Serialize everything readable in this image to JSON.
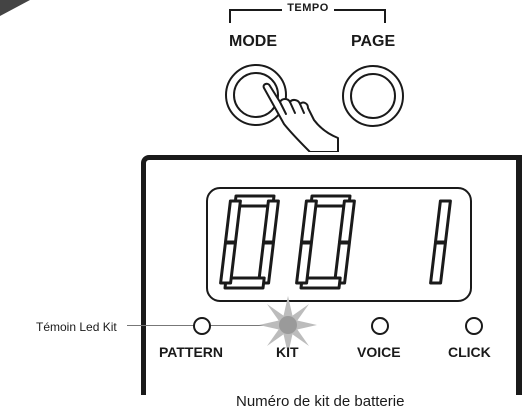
{
  "tempo_group": {
    "label": "TEMPO"
  },
  "buttons": {
    "mode_label": "MODE",
    "page_label": "PAGE"
  },
  "display": {
    "digits": "001"
  },
  "indicators": [
    {
      "label": "PATTERN",
      "lit": false
    },
    {
      "label": "KIT",
      "lit": true
    },
    {
      "label": "VOICE",
      "lit": false
    },
    {
      "label": "CLICK",
      "lit": false
    }
  ],
  "callout": {
    "text": "Témoin Led Kit"
  },
  "caption": "Numéro de kit de batterie"
}
